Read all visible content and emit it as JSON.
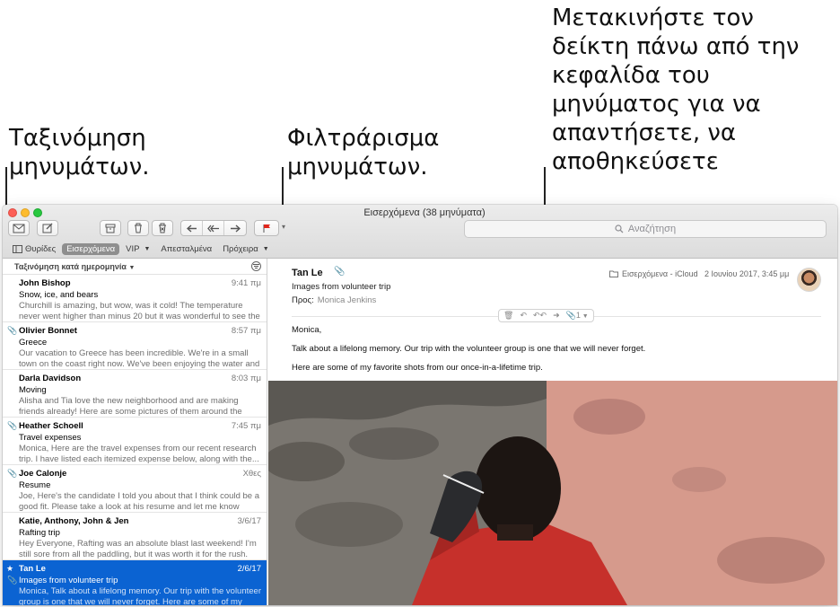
{
  "callouts": {
    "sort": [
      "Ταξινόμηση",
      "μηνυμάτων."
    ],
    "filter": [
      "Φιλτράρισμα",
      "μηνυμάτων."
    ],
    "header": [
      "Μετακινήστε τον",
      "δείκτη πάνω από την",
      "κεφαλίδα του",
      "μηνύματος για να",
      "απαντήσετε, να",
      "αποθηκεύσετε"
    ]
  },
  "window": {
    "title": "Εισερχόμενα (38 μηνύματα)"
  },
  "toolbar": {
    "icons": [
      "compose-envelope-icon",
      "new-message-icon",
      "archive-icon",
      "trash-icon",
      "junk-icon",
      "reply-icon",
      "reply-all-icon",
      "forward-icon",
      "flag-icon"
    ],
    "flag_color": "#e0251b"
  },
  "search": {
    "placeholder": "Αναζήτηση"
  },
  "favorites": [
    {
      "label": "Θυρίδες",
      "active": false
    },
    {
      "label": "Εισερχόμενα",
      "active": true
    },
    {
      "label": "VIP",
      "active": false
    },
    {
      "label": "Απεσταλμένα",
      "active": false
    },
    {
      "label": "Πρόχειρα",
      "active": false
    }
  ],
  "list": {
    "sort_label": "Ταξινόμηση κατά ημερομηνία",
    "messages": [
      {
        "from": "John Bishop",
        "time": "9:41 πμ",
        "subject": "Snow, ice, and bears",
        "preview": "Churchill is amazing, but wow, was it cold! The temperature never went higher than minus 20 but it was wonderful to see the polar..."
      },
      {
        "from": "Olivier Bonnet",
        "time": "8:57 πμ",
        "subject": "Greece",
        "preview": "Our vacation to Greece has been incredible. We're in a small town on the coast right now. We've been enjoying the water and taking..."
      },
      {
        "from": "Darla Davidson",
        "time": "8:03 πμ",
        "subject": "Moving",
        "preview": "Alisha and Tia love the new neighborhood and are making friends already! Here are some pictures of them around the house. Does..."
      },
      {
        "from": "Heather Schoell",
        "time": "7:45 πμ",
        "subject": "Travel expenses",
        "preview": "Monica, Here are the travel expenses from our recent research trip. I have listed each itemized expense below, along with the..."
      },
      {
        "from": "Joe Calonje",
        "time": "Χθες",
        "subject": "Resume",
        "preview": "Joe, Here's the candidate I told you about that I think could be a good fit. Please take a look at his resume and let me know your..."
      },
      {
        "from": "Katie, Anthony, John & Jen",
        "time": "3/6/17",
        "subject": "Rafting trip",
        "preview": "Hey Everyone, Rafting was an absolute blast last weekend! I'm still sore from all the paddling, but it was worth it for the rush. Here are..."
      },
      {
        "from": "Tan Le",
        "time": "2/6/17",
        "subject": "Images from volunteer trip",
        "preview": "Monica, Talk about a lifelong memory. Our trip with the volunteer group is one that we will never forget.  Here are some of my favor..."
      }
    ]
  },
  "message": {
    "from": "Tan Le",
    "subject": "Images from volunteer trip",
    "to_label": "Προς:",
    "to_value": "Monica Jenkins",
    "mailbox": "Εισερχόμενα - iCloud",
    "date": "2 Ιουνίου 2017, 3:45 μμ",
    "attachment_count": "1",
    "greeting": "Monica,",
    "body_1": "Talk about a lifelong memory. Our trip with the volunteer group is one that we will never forget.",
    "body_2": "Here are some of my favorite shots from our once-in-a-lifetime trip."
  },
  "colors": {
    "selection": "#0b63d2",
    "close": "#fc5f57",
    "minimize": "#fdbc2e",
    "zoom": "#28c840"
  }
}
